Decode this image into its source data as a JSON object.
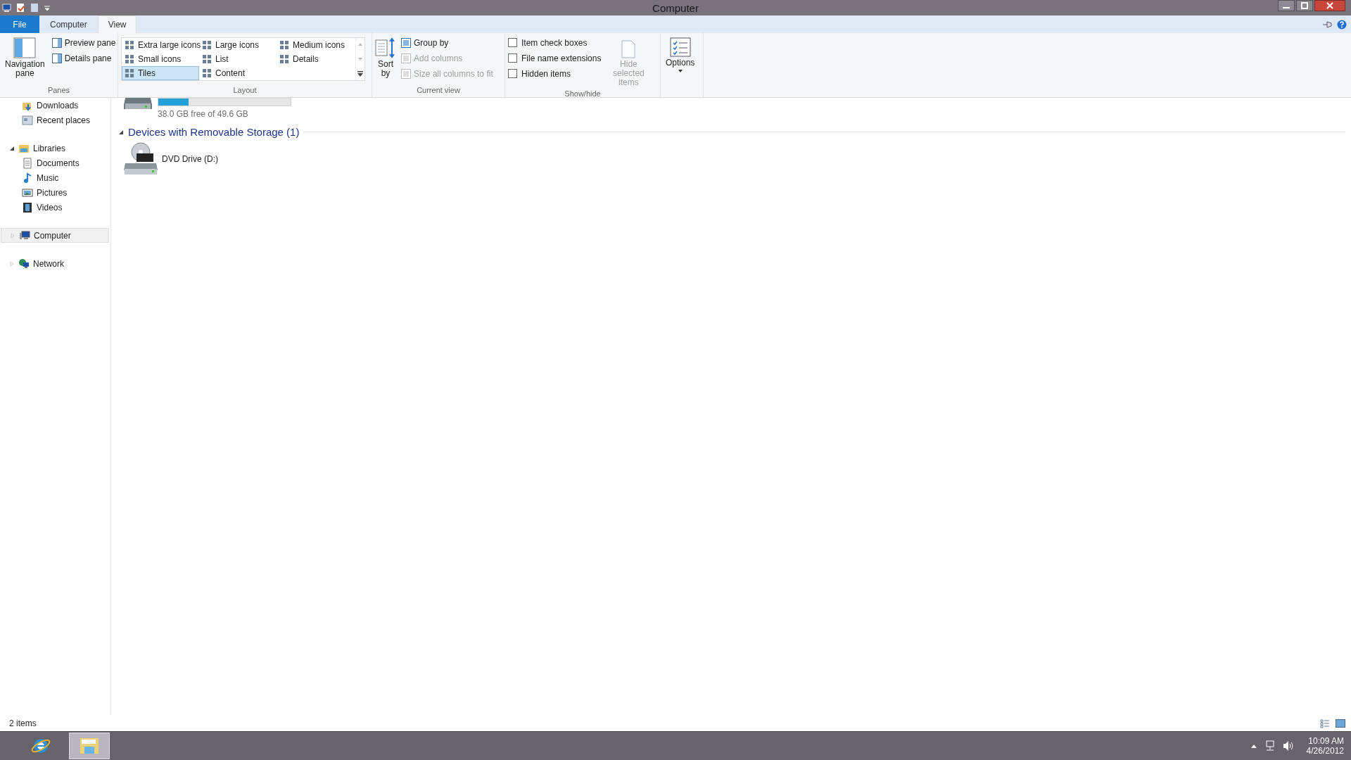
{
  "window": {
    "title": "Computer"
  },
  "ribbon": {
    "tabs": [
      {
        "label": "File",
        "kind": "file",
        "selected": false
      },
      {
        "label": "Computer",
        "kind": "tab",
        "selected": false
      },
      {
        "label": "View",
        "kind": "tab",
        "selected": true
      }
    ],
    "panes": {
      "label": "Panes",
      "navigation_pane": "Navigation pane",
      "items": [
        "Preview pane",
        "Details pane"
      ]
    },
    "layout": {
      "label": "Layout",
      "options": [
        {
          "label": "Extra large icons",
          "selected": false
        },
        {
          "label": "Large icons",
          "selected": false
        },
        {
          "label": "Medium icons",
          "selected": false
        },
        {
          "label": "Small icons",
          "selected": false
        },
        {
          "label": "List",
          "selected": false
        },
        {
          "label": "Details",
          "selected": false
        },
        {
          "label": "Tiles",
          "selected": true
        },
        {
          "label": "Content",
          "selected": false
        }
      ]
    },
    "current_view": {
      "label": "Current view",
      "sort_by": "Sort by",
      "items": [
        {
          "label": "Group by",
          "disabled": false
        },
        {
          "label": "Add columns",
          "disabled": true
        },
        {
          "label": "Size all columns to fit",
          "disabled": true
        }
      ]
    },
    "show_hide": {
      "label": "Show/hide",
      "checkboxes": [
        {
          "label": "Item check boxes",
          "checked": false
        },
        {
          "label": "File name extensions",
          "checked": false
        },
        {
          "label": "Hidden items",
          "checked": false
        }
      ],
      "hide_selected": {
        "label": "Hide selected items",
        "disabled": true
      }
    },
    "options": {
      "label": "Options"
    }
  },
  "nav": [
    {
      "children": [
        {
          "label": "Downloads",
          "kind": "downloads",
          "selected": false
        },
        {
          "label": "Recent places",
          "kind": "recent",
          "selected": false
        }
      ]
    },
    {
      "label": "Libraries",
      "kind": "library",
      "selected": false,
      "expanded": true,
      "children": [
        {
          "label": "Documents",
          "kind": "documents",
          "selected": false
        },
        {
          "label": "Music",
          "kind": "music",
          "selected": false
        },
        {
          "label": "Pictures",
          "kind": "pictures",
          "selected": false
        },
        {
          "label": "Videos",
          "kind": "videos",
          "selected": false
        }
      ]
    },
    {
      "label": "Computer",
      "kind": "computer",
      "selected": true,
      "expanded": false
    },
    {
      "label": "Network",
      "kind": "network",
      "selected": false,
      "expanded": false
    }
  ],
  "content": {
    "partial_tile": {
      "level": 0.23,
      "free": "38.0 GB free of 49.6 GB"
    },
    "groups": [
      {
        "title": "Devices with Removable Storage (1)",
        "expanded": true,
        "items": [
          {
            "name": "DVD Drive (D:)",
            "kind": "dvd"
          }
        ]
      }
    ]
  },
  "status_bar": {
    "count": "2 items"
  },
  "taskbar": {
    "apps": [
      {
        "kind": "browser",
        "selected": false
      },
      {
        "kind": "explorer",
        "selected": true
      }
    ],
    "time": "10:09 AM",
    "date": "4/26/2012"
  }
}
